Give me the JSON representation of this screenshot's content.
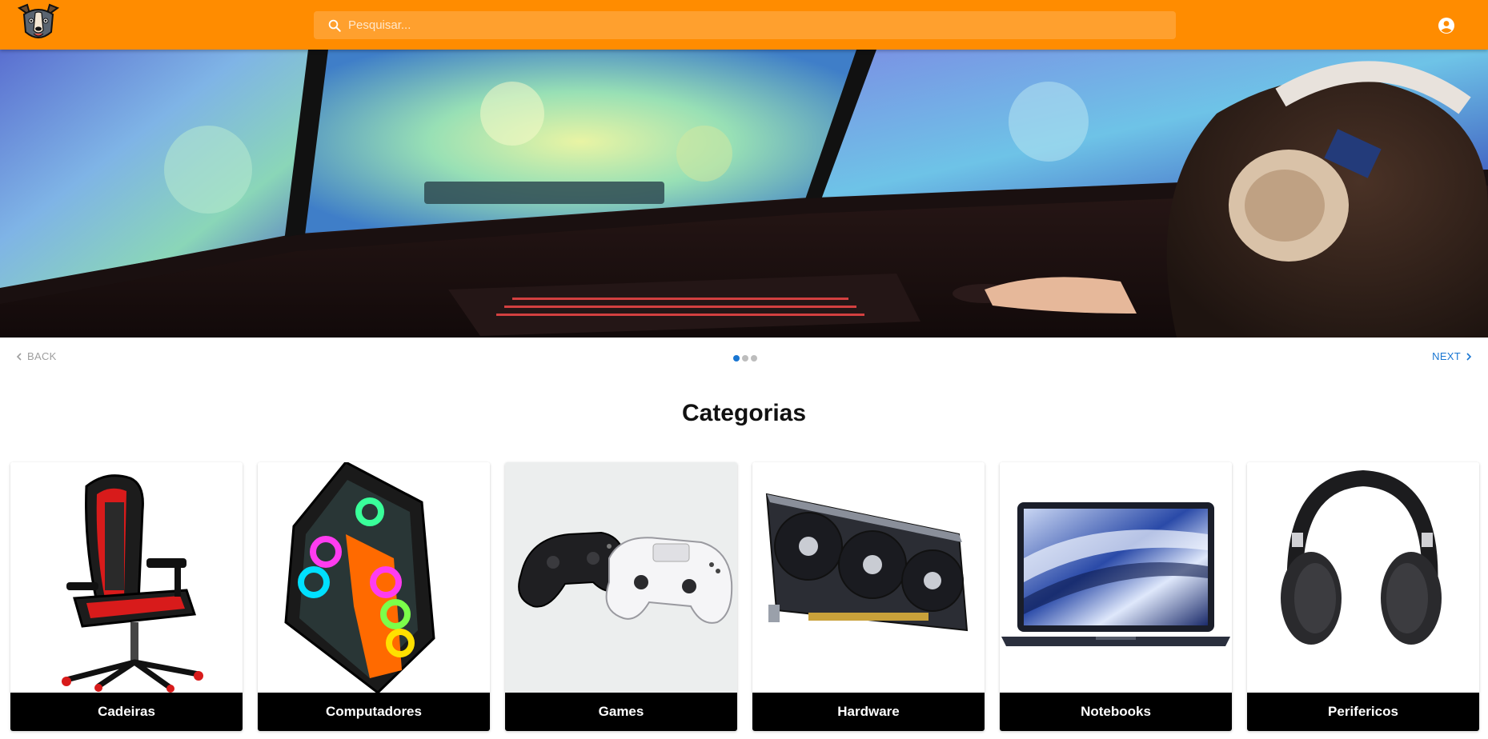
{
  "header": {
    "logo_icon": "dog-logo-icon",
    "search_placeholder": "Pesquisar...",
    "search_icon": "search-icon",
    "account_icon": "account-circle-icon",
    "bar_color": "#ff8c00"
  },
  "carousel": {
    "back_label": "Back",
    "next_label": "Next",
    "slide_count": 3,
    "active_slide": 1,
    "accent_color": "#1976d2"
  },
  "categories": {
    "title": "Categorias",
    "items": [
      {
        "label": "Cadeiras",
        "image_icon": "gaming-chair-image"
      },
      {
        "label": "Computadores",
        "image_icon": "pc-case-image"
      },
      {
        "label": "Games",
        "image_icon": "game-controllers-image"
      },
      {
        "label": "Hardware",
        "image_icon": "graphics-card-image"
      },
      {
        "label": "Notebooks",
        "image_icon": "laptop-image"
      },
      {
        "label": "Perifericos",
        "image_icon": "headphones-image"
      }
    ]
  }
}
